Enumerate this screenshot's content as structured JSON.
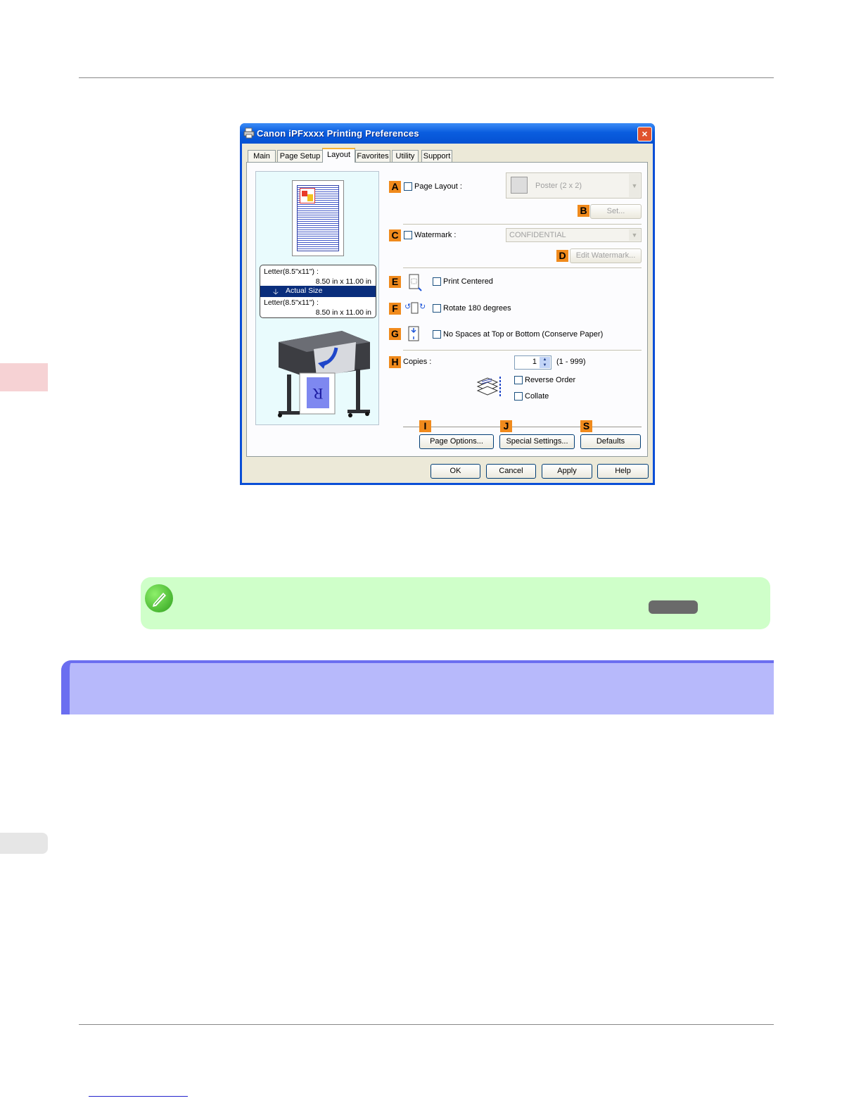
{
  "dialog": {
    "title": "Canon iPFxxxx Printing Preferences",
    "close_icon": "×",
    "tabs": [
      {
        "label": "Main",
        "active": false
      },
      {
        "label": "Page Setup",
        "active": false
      },
      {
        "label": "Layout",
        "active": true
      },
      {
        "label": "Favorites",
        "active": false
      },
      {
        "label": "Utility",
        "active": false
      },
      {
        "label": "Support",
        "active": false
      }
    ],
    "preview": {
      "original_size": "Letter(8.5\"x11\") :",
      "original_dims": "8.50 in x 11.00 in",
      "scaling": "Actual Size",
      "output_size": "Letter(8.5\"x11\") :",
      "output_dims": "8.50 in x 11.00 in",
      "printer_letter": "R"
    },
    "callouts": {
      "A": "A",
      "B": "B",
      "C": "C",
      "D": "D",
      "E": "E",
      "F": "F",
      "G": "G",
      "H": "H",
      "I": "I",
      "J": "J",
      "S": "S"
    },
    "page_layout": {
      "label": "Page Layout :",
      "checked": false,
      "combo_value": "Poster (2 x 2)",
      "set_button": "Set..."
    },
    "watermark": {
      "label": "Watermark :",
      "checked": false,
      "combo_value": "CONFIDENTIAL",
      "edit_button": "Edit Watermark..."
    },
    "print_centered": {
      "label": "Print Centered",
      "checked": false
    },
    "rotate": {
      "label": "Rotate 180 degrees",
      "checked": false
    },
    "no_spaces": {
      "label": "No Spaces at Top or Bottom (Conserve Paper)",
      "checked": false
    },
    "copies": {
      "label": "Copies :",
      "value": "1",
      "range": "(1 - 999)"
    },
    "reverse_order": {
      "label": "Reverse Order",
      "checked": false
    },
    "collate": {
      "label": "Collate",
      "checked": false
    },
    "buttons": {
      "page_options": "Page Options...",
      "special_settings": "Special Settings...",
      "defaults": "Defaults"
    },
    "footer_buttons": {
      "ok": "OK",
      "cancel": "Cancel",
      "apply": "Apply",
      "help": "Help"
    },
    "colors": {
      "title_bar": "#0a5ddf",
      "callout": "#f08a1c",
      "client": "#ece9d8"
    }
  },
  "note": {
    "icon": "pencil-check-icon",
    "background": "#cfffc9"
  },
  "section_heading": {
    "background": "#b7b9fb",
    "accent": "#6b6ef0"
  }
}
